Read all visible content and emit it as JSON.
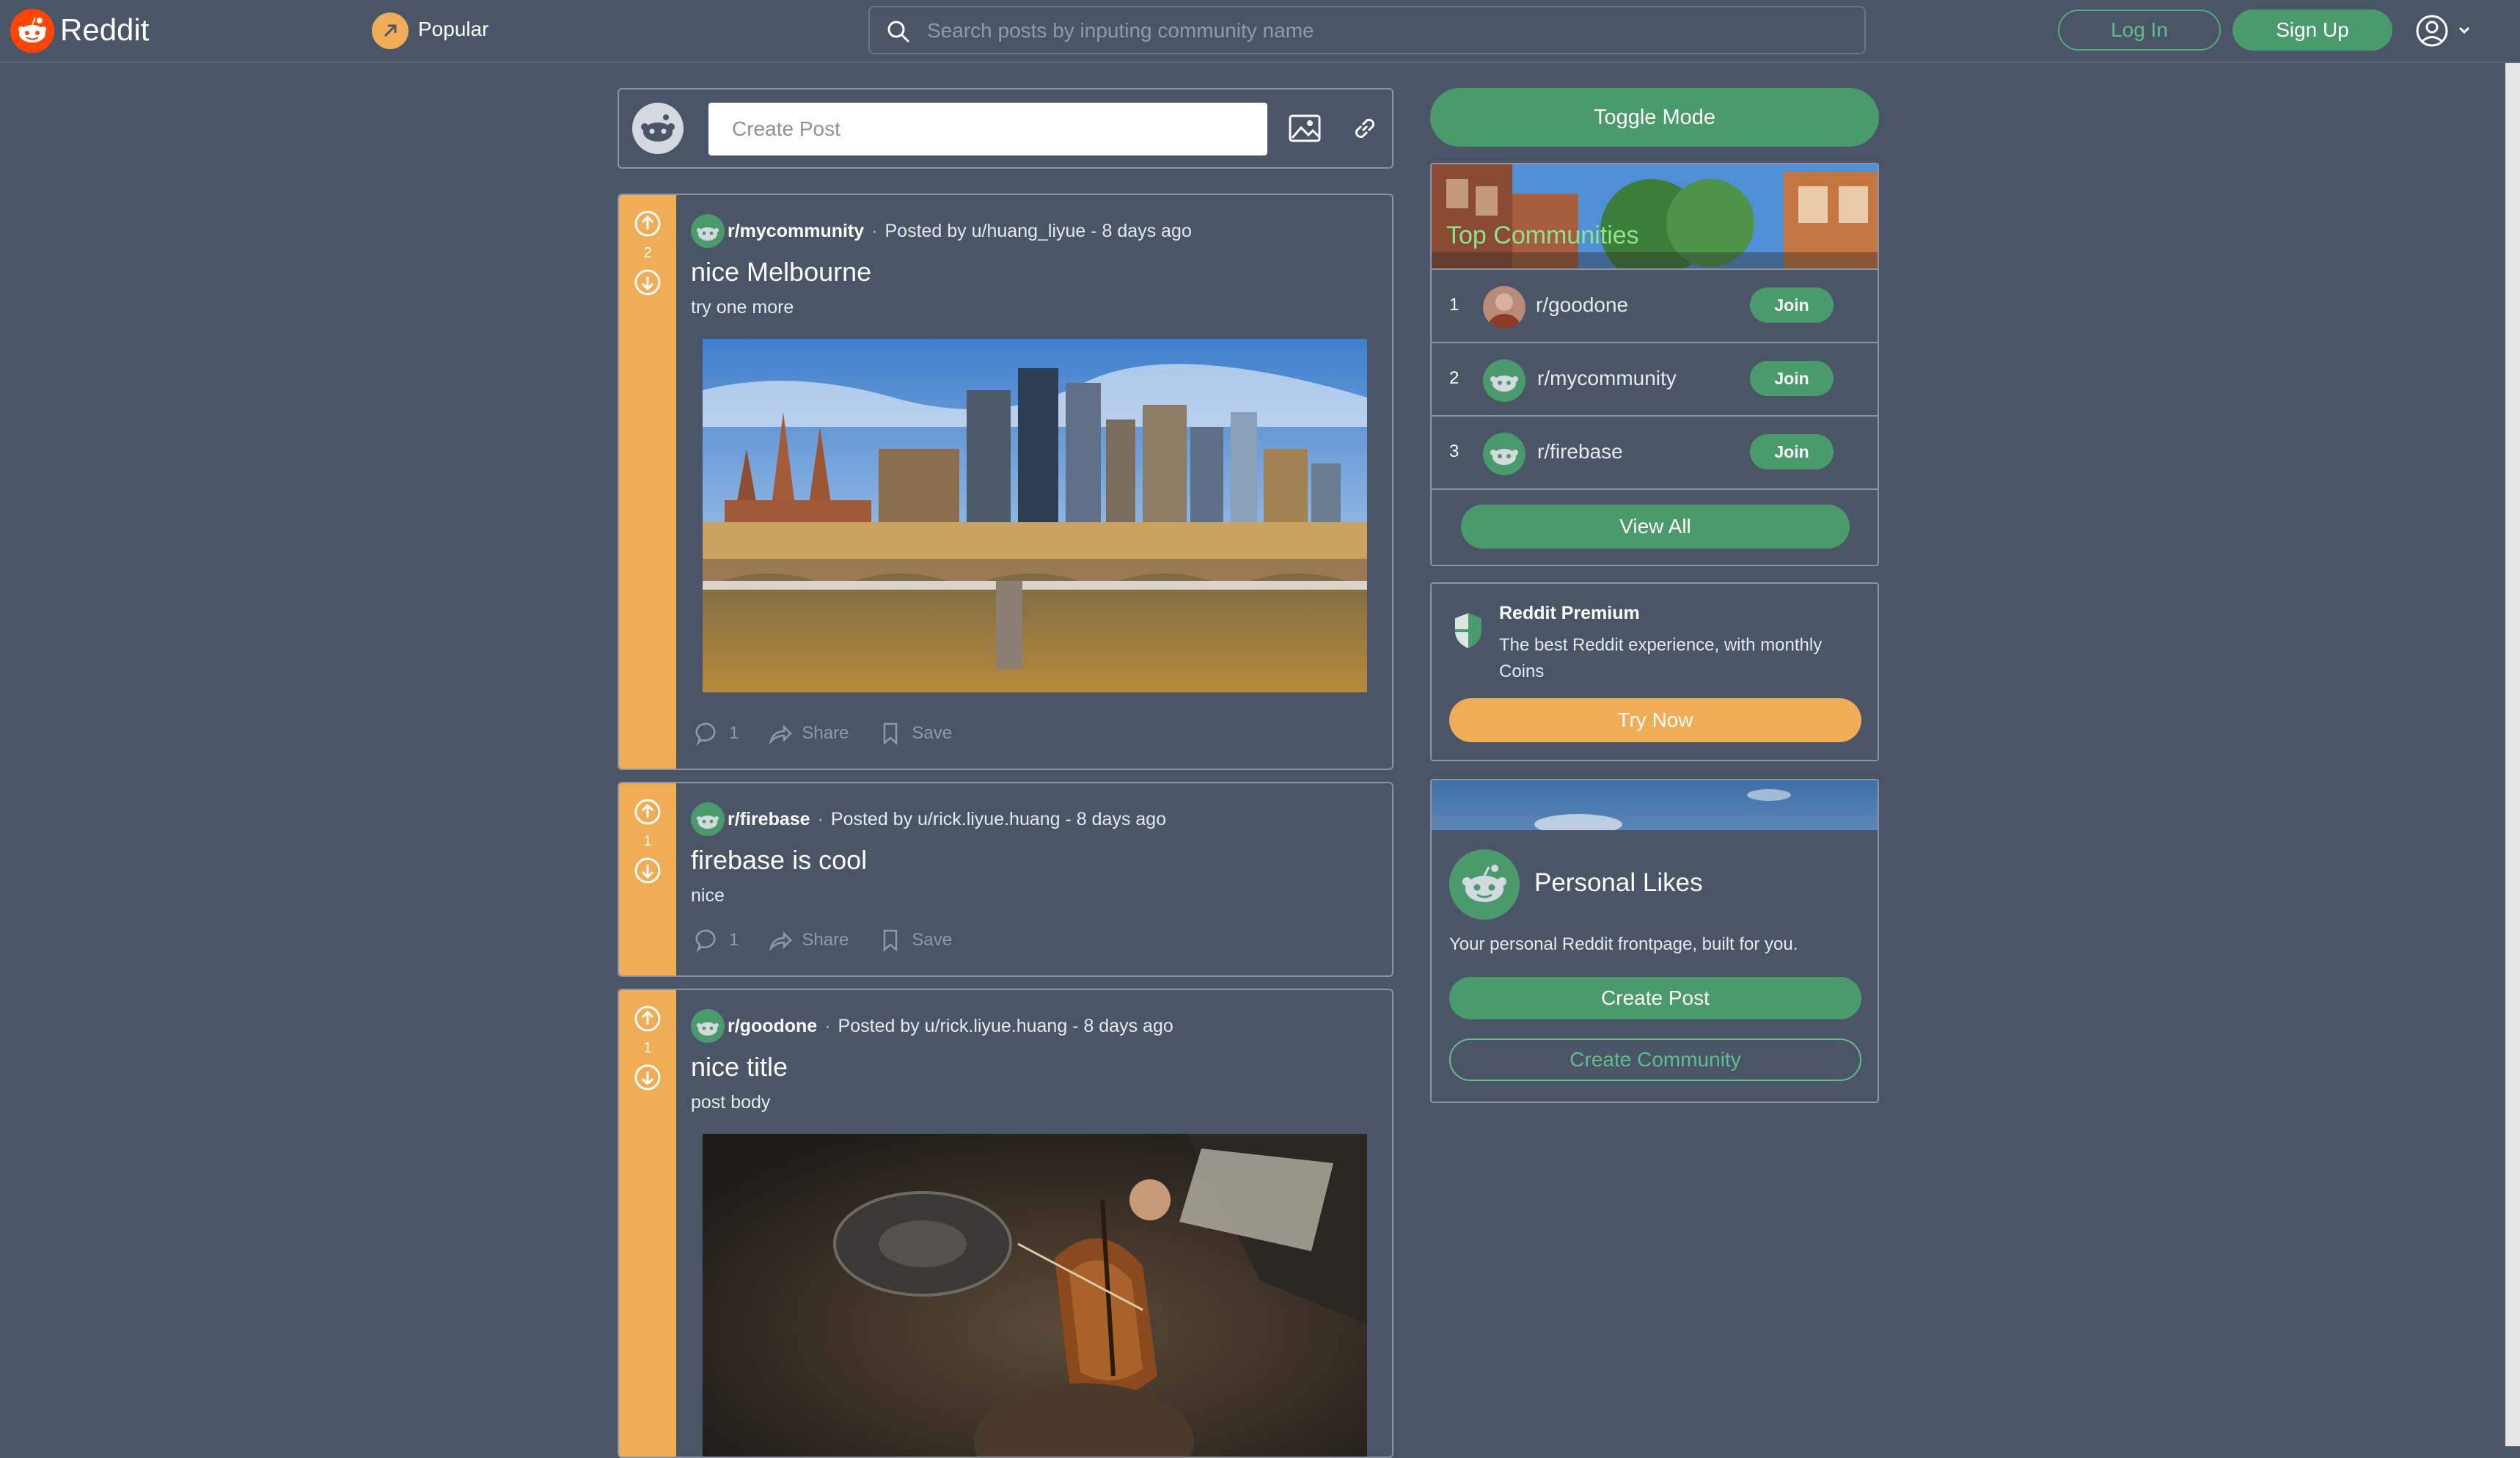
{
  "header": {
    "app_name": "Reddit",
    "feed_label": "Popular",
    "search_placeholder": "Search posts by inputing community name",
    "login_label": "Log In",
    "signup_label": "Sign Up",
    "user_menu_icon": "user-circle-icon"
  },
  "create_post": {
    "placeholder": "Create Post"
  },
  "posts": [
    {
      "community": "r/mycommunity",
      "posted_by": "Posted by u/huang_liyue - 8 days ago",
      "votes": "2",
      "title": "nice Melbourne",
      "body": "try one more",
      "comments": "1",
      "share_label": "Share",
      "save_label": "Save"
    },
    {
      "community": "r/firebase",
      "posted_by": "Posted by u/rick.liyue.huang - 8 days ago",
      "votes": "1",
      "title": "firebase is cool",
      "body": "nice",
      "comments": "1",
      "share_label": "Share",
      "save_label": "Save"
    },
    {
      "community": "r/goodone",
      "posted_by": "Posted by u/rick.liyue.huang - 8 days ago",
      "votes": "1",
      "title": "nice title",
      "body": "post body"
    }
  ],
  "sidebar": {
    "toggle_label": "Toggle Mode",
    "top_communities": {
      "title": "Top Communities",
      "items": [
        {
          "rank": "1",
          "name": "r/goodone",
          "join_label": "Join"
        },
        {
          "rank": "2",
          "name": "r/mycommunity",
          "join_label": "Join"
        },
        {
          "rank": "3",
          "name": "r/firebase",
          "join_label": "Join"
        }
      ],
      "view_all_label": "View All"
    },
    "premium": {
      "title": "Reddit Premium",
      "description": "The best Reddit experience, with monthly Coins",
      "cta_label": "Try Now"
    },
    "personal": {
      "title": "Personal Likes",
      "description": "Your personal Reddit frontpage, built for you.",
      "create_post_label": "Create Post",
      "create_community_label": "Create Community"
    }
  },
  "colors": {
    "background": "#4a5568",
    "accent_green": "#4a9b6c",
    "accent_orange": "#f0ad55",
    "brand_red": "#ff4500"
  }
}
